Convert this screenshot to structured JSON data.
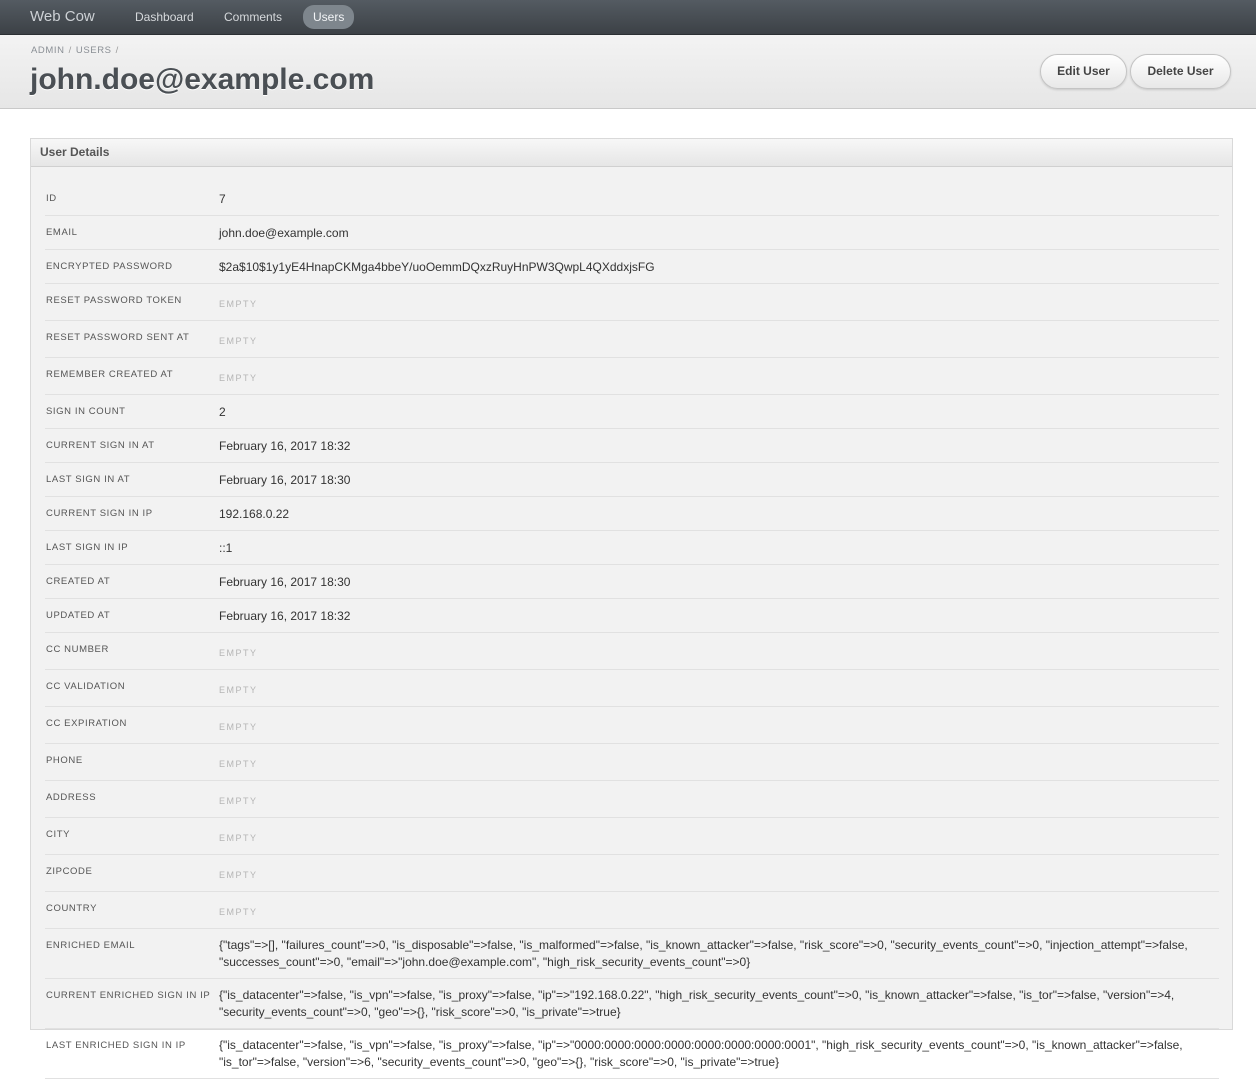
{
  "nav": {
    "brand": "Web Cow",
    "links": [
      "Dashboard",
      "Comments",
      "Users"
    ],
    "active": "Users"
  },
  "header": {
    "breadcrumb": [
      "ADMIN",
      "USERS"
    ],
    "title": "john.doe@example.com",
    "edit_label": "Edit User",
    "delete_label": "Delete User"
  },
  "panel": {
    "title": "User Details",
    "empty_text": "EMPTY",
    "fields": [
      {
        "label": "ID",
        "value": "7"
      },
      {
        "label": "EMAIL",
        "value": "john.doe@example.com"
      },
      {
        "label": "ENCRYPTED PASSWORD",
        "value": "$2a$10$1y1yE4HnapCKMga4bbeY/uoOemmDQxzRuyHnPW3QwpL4QXddxjsFG"
      },
      {
        "label": "RESET PASSWORD TOKEN",
        "value": null
      },
      {
        "label": "RESET PASSWORD SENT AT",
        "value": null
      },
      {
        "label": "REMEMBER CREATED AT",
        "value": null
      },
      {
        "label": "SIGN IN COUNT",
        "value": "2"
      },
      {
        "label": "CURRENT SIGN IN AT",
        "value": "February 16, 2017 18:32"
      },
      {
        "label": "LAST SIGN IN AT",
        "value": "February 16, 2017 18:30"
      },
      {
        "label": "CURRENT SIGN IN IP",
        "value": "192.168.0.22"
      },
      {
        "label": "LAST SIGN IN IP",
        "value": "::1"
      },
      {
        "label": "CREATED AT",
        "value": "February 16, 2017 18:30"
      },
      {
        "label": "UPDATED AT",
        "value": "February 16, 2017 18:32"
      },
      {
        "label": "CC NUMBER",
        "value": null
      },
      {
        "label": "CC VALIDATION",
        "value": null
      },
      {
        "label": "CC EXPIRATION",
        "value": null
      },
      {
        "label": "PHONE",
        "value": null
      },
      {
        "label": "ADDRESS",
        "value": null
      },
      {
        "label": "CITY",
        "value": null
      },
      {
        "label": "ZIPCODE",
        "value": null
      },
      {
        "label": "COUNTRY",
        "value": null
      },
      {
        "label": "ENRICHED EMAIL",
        "value": "{\"tags\"=>[], \"failures_count\"=>0, \"is_disposable\"=>false, \"is_malformed\"=>false, \"is_known_attacker\"=>false, \"risk_score\"=>0, \"security_events_count\"=>0, \"injection_attempt\"=>false, \"successes_count\"=>0, \"email\"=>\"john.doe@example.com\", \"high_risk_security_events_count\"=>0}"
      },
      {
        "label": "CURRENT ENRICHED SIGN IN IP",
        "value": "{\"is_datacenter\"=>false, \"is_vpn\"=>false, \"is_proxy\"=>false, \"ip\"=>\"192.168.0.22\", \"high_risk_security_events_count\"=>0, \"is_known_attacker\"=>false, \"is_tor\"=>false, \"version\"=>4, \"security_events_count\"=>0, \"geo\"=>{}, \"risk_score\"=>0, \"is_private\"=>true}"
      },
      {
        "label": "LAST ENRICHED SIGN IN IP",
        "value": "{\"is_datacenter\"=>false, \"is_vpn\"=>false, \"is_proxy\"=>false, \"ip\"=>\"0000:0000:0000:0000:0000:0000:0000:0001\", \"high_risk_security_events_count\"=>0, \"is_known_attacker\"=>false, \"is_tor\"=>false, \"version\"=>6, \"security_events_count\"=>0, \"geo\"=>{}, \"risk_score\"=>0, \"is_private\"=>true}"
      }
    ]
  }
}
